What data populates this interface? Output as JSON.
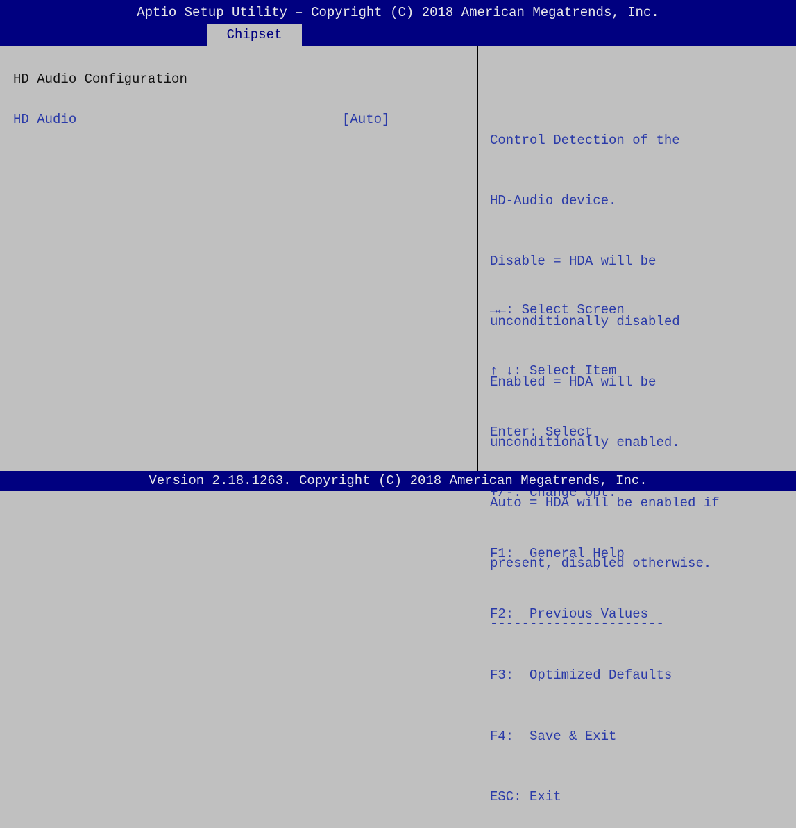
{
  "header": {
    "title": "Aptio Setup Utility – Copyright (C) 2018 American Megatrends, Inc.",
    "active_tab": "Chipset"
  },
  "main": {
    "section_title": "HD Audio Configuration",
    "settings": [
      {
        "label": "HD Audio",
        "value": "[Auto]"
      }
    ]
  },
  "help_panel": {
    "description_lines": [
      "Control Detection of the",
      "HD-Audio device.",
      "Disable = HDA will be",
      "unconditionally disabled",
      "Enabled = HDA will be",
      "unconditionally enabled.",
      "Auto = HDA will be enabled if",
      "present, disabled otherwise."
    ],
    "separator": "----------------------",
    "key_hints": [
      "→←: Select Screen",
      "↑ ↓: Select Item",
      "Enter: Select",
      "+/-: Change Opt.",
      "F1:  General Help",
      "F2:  Previous Values",
      "F3:  Optimized Defaults",
      "F4:  Save & Exit",
      "ESC: Exit"
    ]
  },
  "footer": {
    "text": "Version 2.18.1263. Copyright (C) 2018 American Megatrends, Inc."
  },
  "colors": {
    "header_bg": "#000080",
    "body_bg": "#c0c0c0",
    "highlight_text": "#2a3aa8",
    "header_text": "#e8e8e8"
  }
}
